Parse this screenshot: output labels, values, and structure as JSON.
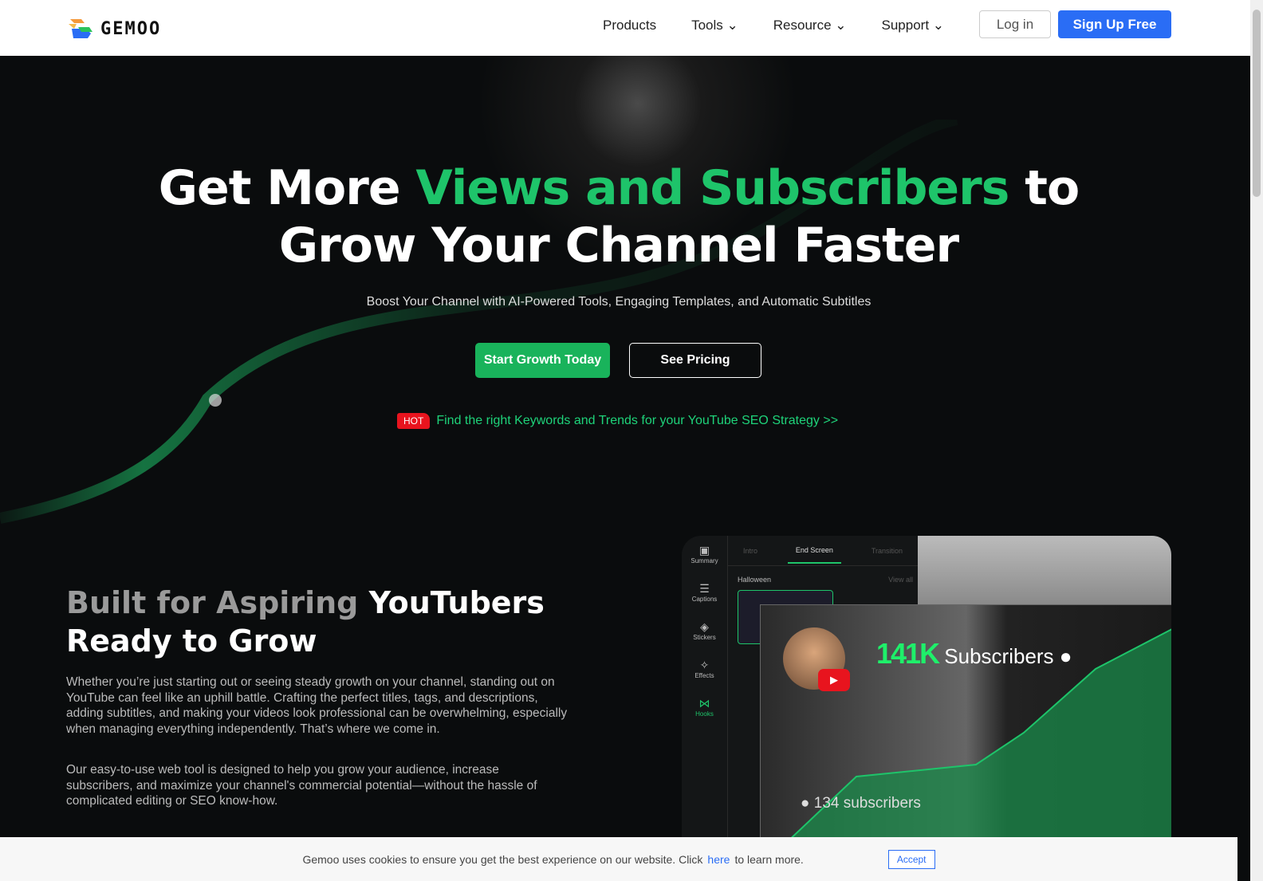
{
  "brand": {
    "name": "GEMOO"
  },
  "nav": {
    "items": [
      "Products",
      "Tools",
      "Resource",
      "Support"
    ],
    "login": "Log in",
    "signup": "Sign Up Free"
  },
  "hero": {
    "title_a": "Get More ",
    "title_green": "Views and Subscribers",
    "title_b": " to",
    "title_line2": "Grow Your Channel Faster",
    "subtitle": "Boost Your Channel with AI-Powered Tools, Engaging Templates, and Automatic Subtitles",
    "cta_primary": "Start Growth Today",
    "cta_secondary": "See Pricing",
    "hot_badge": "HOT",
    "hot_link": "Find the right Keywords and Trends for your YouTube SEO Strategy >>"
  },
  "section": {
    "title_muted": "Built for Aspiring ",
    "title_white": "YouTubers",
    "title_line2": "Ready to Grow",
    "p1": "Whether you’re just starting out or seeing steady growth on your channel, standing out on YouTube can feel like an uphill battle. Crafting the perfect titles, tags, and descriptions, adding subtitles, and making your videos look professional can be overwhelming, especially when managing everything independently. That’s where we come in.",
    "p2": "Our easy-to-use web tool is designed to help you grow your audience, increase subscribers, and maximize your channel's commercial potential—without the hassle of complicated editing or SEO know-how."
  },
  "mockup": {
    "sidebar": [
      "Summary",
      "Captions",
      "Stickers",
      "Effects",
      "Hooks"
    ],
    "tabs": [
      "Intro",
      "End Screen",
      "Transition"
    ],
    "group": "Halloween",
    "view_all": "View all",
    "big_count": "141K",
    "big_label": " Subscribers",
    "small_label": "134 subscribers"
  },
  "cookie": {
    "text": "Gemoo uses cookies to ensure you get the best experience on our website. Click",
    "link": "here",
    "text2": "to learn more.",
    "accept": "Accept"
  },
  "colors": {
    "accent_green": "#1ec46a",
    "signup_blue": "#2a6df5",
    "hot_red": "#e8141e"
  }
}
